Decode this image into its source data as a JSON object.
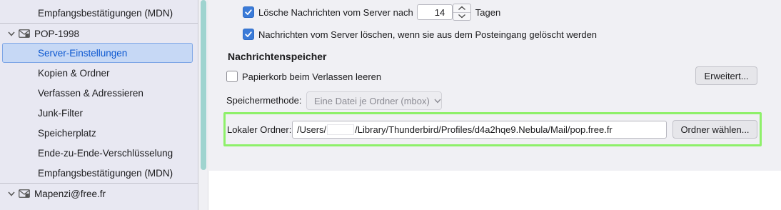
{
  "sidebar": {
    "top_item": "Empfangsbestätigungen (MDN)",
    "account1": {
      "name": "POP-1998"
    },
    "items": [
      {
        "label": "Server-Einstellungen",
        "selected": true
      },
      {
        "label": "Kopien & Ordner"
      },
      {
        "label": "Verfassen & Adressieren"
      },
      {
        "label": "Junk-Filter"
      },
      {
        "label": "Speicherplatz"
      },
      {
        "label": "Ende-zu-Ende-Verschlüsselung"
      },
      {
        "label": "Empfangsbestätigungen (MDN)"
      }
    ],
    "account2": {
      "name": "Mapenzi@free.fr"
    }
  },
  "settings": {
    "delete_after": {
      "label": "Lösche Nachrichten vom Server nach",
      "checked": true,
      "days_value": "14",
      "unit": "Tagen"
    },
    "delete_when_removed": {
      "label": "Nachrichten vom Server löschen, wenn sie aus dem Posteingang gelöscht werden",
      "checked": true
    },
    "storage_section": {
      "title": "Nachrichtenspeicher",
      "empty_trash": {
        "label": "Papierkorb beim Verlassen leeren",
        "checked": false
      },
      "advanced_button": "Erweitert...",
      "method_label": "Speichermethode:",
      "method_value": "Eine Datei je Ordner (mbox)",
      "local_folder_label": "Lokaler Ordner:",
      "local_folder_path_prefix": "/Users/",
      "local_folder_path_suffix": "/Library/Thunderbird/Profiles/d4a2hqe9.Nebula/Mail/pop.free.fr",
      "choose_folder_button": "Ordner wählen..."
    }
  },
  "colors": {
    "accent": "#3b7bd8",
    "selection_bg": "#c6d8f5",
    "selection_text": "#0b57d0",
    "highlight_frame": "#8ef06a"
  }
}
